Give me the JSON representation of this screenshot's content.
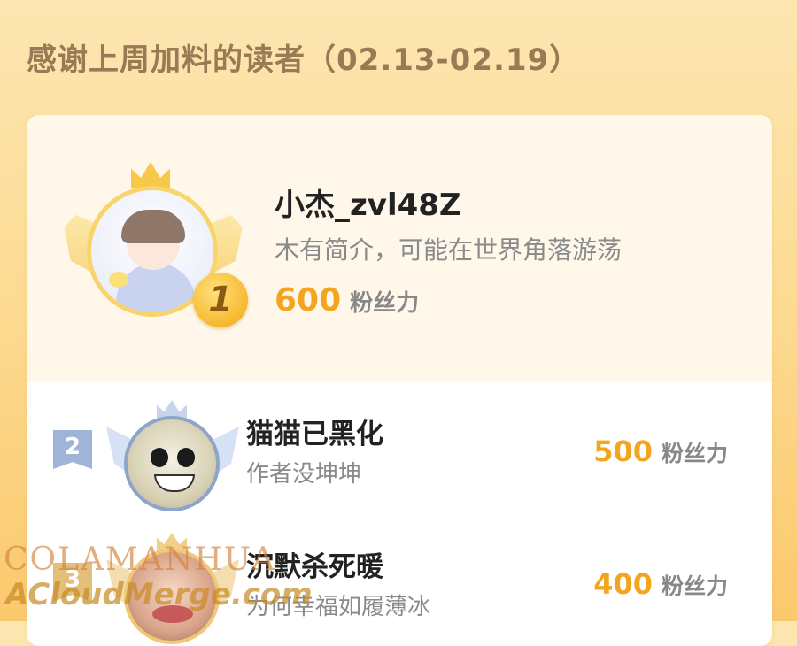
{
  "page": {
    "title": "感谢上周加料的读者（02.13-02.19）"
  },
  "top_reader": {
    "rank": "1",
    "name": "小杰_zvl48Z",
    "bio": "木有简介，可能在世界角落游荡",
    "fans_value": "600",
    "fans_unit": "粉丝力"
  },
  "readers": [
    {
      "rank": "2",
      "name": "猫猫已黑化",
      "bio": "作者没坤坤",
      "fans_value": "500",
      "fans_unit": "粉丝力"
    },
    {
      "rank": "3",
      "name": "沉默杀死暖",
      "bio": "为何幸福如履薄冰",
      "fans_value": "400",
      "fans_unit": "粉丝力"
    }
  ],
  "watermark": {
    "line1": "COLAMANHUA",
    "line2": "ACloudMerge.com"
  },
  "colors": {
    "accent": "#f3a520",
    "gold_medal": "#f6b92f",
    "silver": "#9fb4d6",
    "bronze": "#e3bf7a",
    "background": "#fcd98e"
  }
}
